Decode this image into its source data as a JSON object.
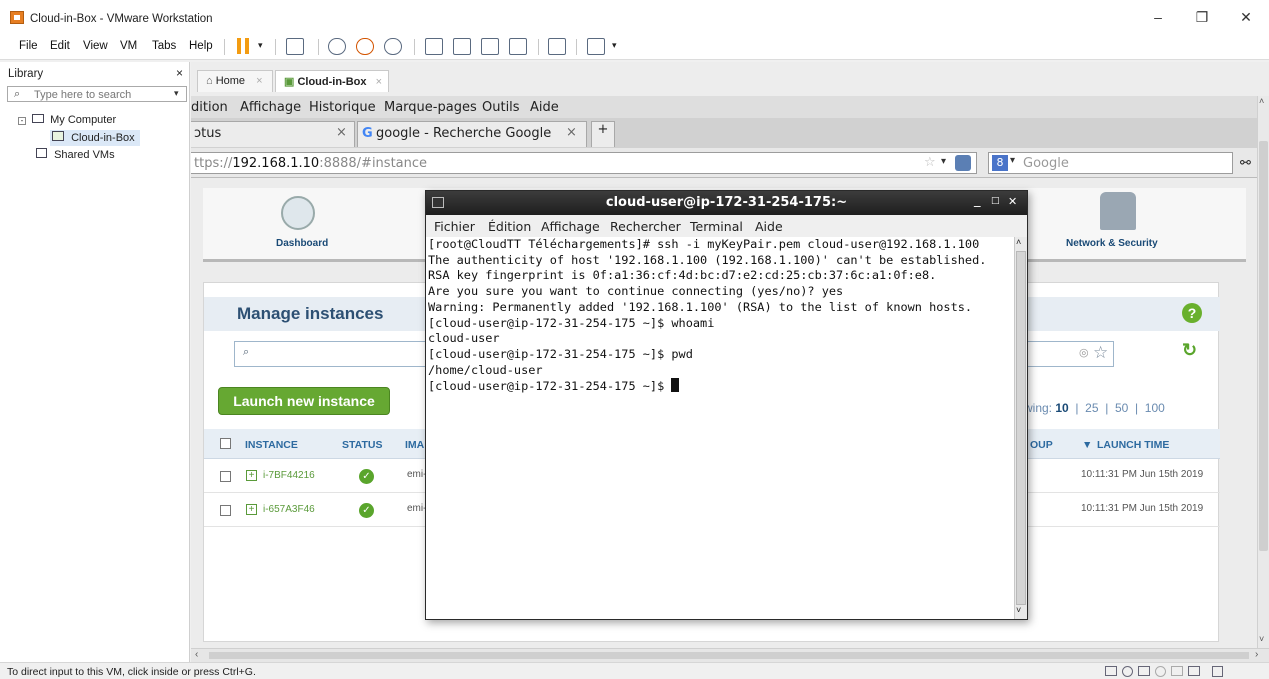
{
  "window": {
    "title": "Cloud-in-Box - VMware Workstation",
    "minimize": "–",
    "restore": "❐",
    "close": "✕"
  },
  "menubar": {
    "items": [
      "File",
      "Edit",
      "View",
      "VM",
      "Tabs",
      "Help"
    ]
  },
  "library": {
    "title": "Library",
    "close": "×",
    "search_placeholder": "Type here to search",
    "tree": {
      "root": "My Computer",
      "vm": "Cloud-in-Box",
      "shared": "Shared VMs"
    }
  },
  "vm_tabs": {
    "home": "Home",
    "active": "Cloud-in-Box",
    "close": "×"
  },
  "firefox": {
    "menu": [
      "dition",
      "Affichage",
      "Historique",
      "Marque-pages",
      "Outils",
      "Aide"
    ],
    "tabs": {
      "first": "ɔtus",
      "second": "google - Recherche Google",
      "close": "×",
      "new_tab": "+"
    },
    "url": {
      "prefix": "ttps://",
      "host": "192.168.1.10",
      "rest": ":8888/#instance"
    },
    "search_engine": "Google"
  },
  "webapp": {
    "nav": {
      "dashboard": "Dashboard",
      "network": "Network & Security"
    },
    "manage_title": "Manage instances",
    "help": "?",
    "launch_button": "Launch new instance",
    "showing": {
      "prefix": "wing:",
      "current": "10",
      "options": [
        "25",
        "50",
        "100"
      ]
    },
    "columns": {
      "instance": "INSTANCE",
      "status": "STATUS",
      "image": "IMA",
      "group": "OUP",
      "launch_time": "LAUNCH TIME"
    },
    "rows": [
      {
        "id": "i-7BF44216",
        "image": "emi-",
        "launch_time": "10:11:31 PM Jun 15th 2019"
      },
      {
        "id": "i-657A3F46",
        "image": "emi-",
        "launch_time": "10:11:31 PM Jun 15th 2019"
      }
    ]
  },
  "terminal": {
    "title": "cloud-user@ip-172-31-254-175:~",
    "menu": [
      "Fichier",
      "Édition",
      "Affichage",
      "Rechercher",
      "Terminal",
      "Aide"
    ],
    "lines": [
      "[root@CloudTT Téléchargements]# ssh -i myKeyPair.pem cloud-user@192.168.1.100",
      "The authenticity of host '192.168.1.100 (192.168.1.100)' can't be established.",
      "RSA key fingerprint is 0f:a1:36:cf:4d:bc:d7:e2:cd:25:cb:37:6c:a1:0f:e8.",
      "Are you sure you want to continue connecting (yes/no)? yes",
      "Warning: Permanently added '192.168.1.100' (RSA) to the list of known hosts.",
      "[cloud-user@ip-172-31-254-175 ~]$ whoami",
      "cloud-user",
      "[cloud-user@ip-172-31-254-175 ~]$ pwd",
      "/home/cloud-user",
      "[cloud-user@ip-172-31-254-175 ~]$ "
    ]
  },
  "statusbar": {
    "message": "To direct input to this VM, click inside or press Ctrl+G."
  }
}
